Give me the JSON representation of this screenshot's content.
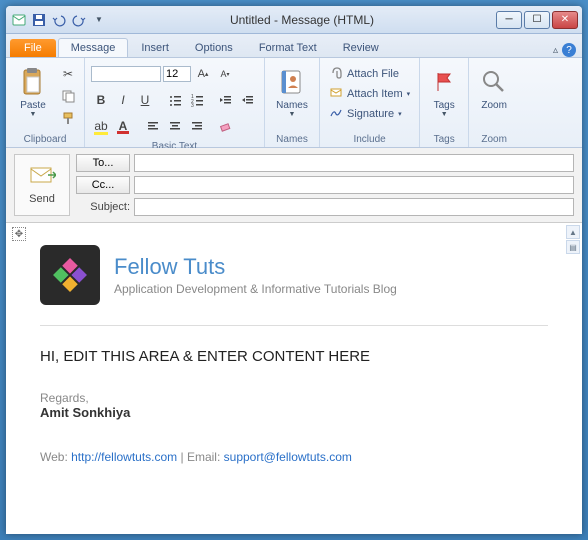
{
  "window": {
    "title": "Untitled - Message (HTML)"
  },
  "ribbon": {
    "file": "File",
    "tabs": [
      "Message",
      "Insert",
      "Options",
      "Format Text",
      "Review"
    ],
    "clipboard": {
      "paste": "Paste",
      "group": "Clipboard"
    },
    "basictext": {
      "group": "Basic Text",
      "font_size": "12"
    },
    "names": {
      "label": "Names",
      "group": "Names"
    },
    "include": {
      "attach_file": "Attach File",
      "attach_item": "Attach Item",
      "signature": "Signature",
      "group": "Include"
    },
    "tags": {
      "label": "Tags",
      "group": "Tags"
    },
    "zoom": {
      "label": "Zoom",
      "group": "Zoom"
    }
  },
  "compose": {
    "send": "Send",
    "to": "To...",
    "cc": "Cc...",
    "subject_label": "Subject:",
    "to_val": "",
    "cc_val": "",
    "subject_val": ""
  },
  "body": {
    "brand": "Fellow Tuts",
    "tagline": "Application Development & Informative Tutorials Blog",
    "placeholder": "HI, EDIT THIS AREA & ENTER CONTENT HERE",
    "regards": "Regards,",
    "name": "Amit Sonkhiya",
    "web_label": "Web: ",
    "web_url": "http://fellowtuts.com",
    "sep": " | Email: ",
    "email": "support@fellowtuts.com"
  }
}
